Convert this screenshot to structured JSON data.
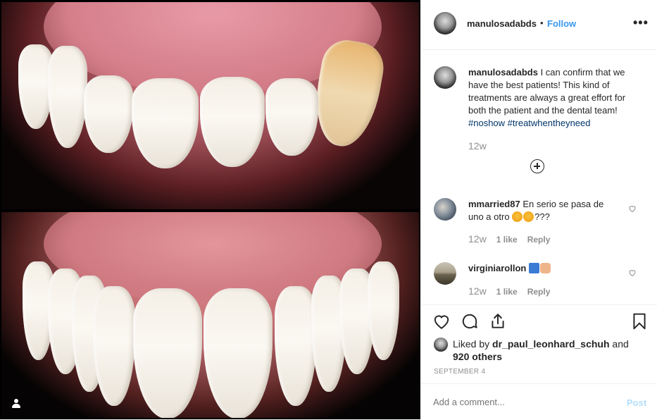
{
  "post": {
    "username": "manulosadabds",
    "separator": "•",
    "follow_label": "Follow",
    "more_icon": "•••",
    "caption": {
      "username": "manulosadabds",
      "text": " I can confirm that we have the best patients! This kind of treatments are always a great effort for both the patient and the dental team! ",
      "hashtags": [
        "#noshow",
        "#treatwhentheyneed"
      ],
      "time": "12w"
    },
    "comments": [
      {
        "username": "mmarried87",
        "text": " En serio se pasa de uno a otro ",
        "suffix": "???",
        "time": "12w",
        "likes": "1 like",
        "reply": "Reply"
      },
      {
        "username": "virginiarollon",
        "text": " ",
        "time": "12w",
        "likes": "1 like",
        "reply": "Reply"
      }
    ],
    "liked_by": {
      "prefix": "Liked by ",
      "user": "dr_paul_leonhard_schuh",
      "middle": " and ",
      "others": "920 others"
    },
    "date": "SEPTEMBER 4",
    "add_comment_placeholder": "Add a comment...",
    "post_label": "Post"
  },
  "colors": {
    "link": "#3897f0",
    "hashtag": "#003569",
    "muted": "#8e8e8e",
    "post_disabled": "#b2dffc"
  },
  "icons": [
    "heart-icon",
    "comment-icon",
    "share-icon",
    "bookmark-icon",
    "plus-circle-icon",
    "user-tag-icon",
    "more-icon"
  ]
}
